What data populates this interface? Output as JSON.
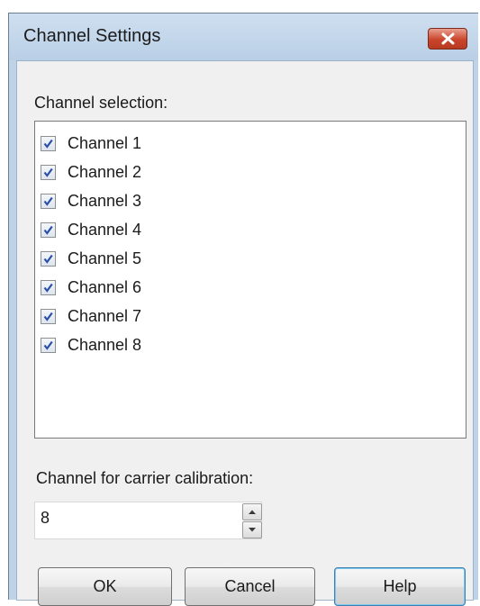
{
  "window": {
    "title": "Channel Settings"
  },
  "channel_selection": {
    "label": "Channel selection:",
    "items": [
      {
        "label": "Channel 1",
        "checked": true
      },
      {
        "label": "Channel 2",
        "checked": true
      },
      {
        "label": "Channel 3",
        "checked": true
      },
      {
        "label": "Channel 4",
        "checked": true
      },
      {
        "label": "Channel 5",
        "checked": true
      },
      {
        "label": "Channel 6",
        "checked": true
      },
      {
        "label": "Channel 7",
        "checked": true
      },
      {
        "label": "Channel 8",
        "checked": true
      }
    ]
  },
  "carrier_calibration": {
    "label": "Channel for carrier calibration:",
    "value": "8"
  },
  "buttons": {
    "ok": "OK",
    "cancel": "Cancel",
    "help": "Help"
  },
  "colors": {
    "titlebar": "#bfd3e8",
    "close_button": "#c9452b",
    "checkmark": "#2a4fa8",
    "client_background": "#f0f0f0"
  },
  "icons": {
    "close": "close-icon",
    "checkmark": "checkmark-icon",
    "spin_up": "chevron-up-icon",
    "spin_down": "chevron-down-icon"
  }
}
